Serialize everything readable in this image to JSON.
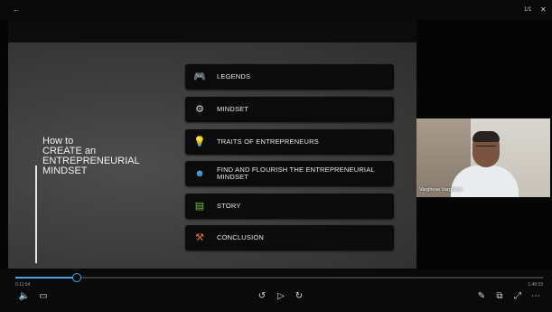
{
  "window": {
    "back_icon": "back-arrow-icon",
    "top_right_label": "1/1",
    "close_icon": "close-icon"
  },
  "slide": {
    "title_lines": [
      "How to",
      "CREATE an",
      "ENTREPRENEURIAL",
      "MINDSET"
    ],
    "menu": [
      {
        "label": "LEGENDS",
        "icon": "gamepad-icon",
        "glyph": "🎮",
        "color": "#e8703a"
      },
      {
        "label": "MINDSET",
        "icon": "head-gear-icon",
        "glyph": "⚙",
        "color": "#d9d9d9"
      },
      {
        "label": "TRAITS OF ENTREPRENEURS",
        "icon": "lightbulb-icon",
        "glyph": "💡",
        "color": "#f2c531"
      },
      {
        "label": "FIND AND FLOURISH THE ENTREPRENEURIAL MINDSET",
        "icon": "head-idea-icon",
        "glyph": "☻",
        "color": "#4aa3e8"
      },
      {
        "label": "STORY",
        "icon": "book-icon",
        "glyph": "▤",
        "color": "#6fc24a"
      },
      {
        "label": "CONCLUSION",
        "icon": "gavel-icon",
        "glyph": "⚒",
        "color": "#e8703a"
      }
    ]
  },
  "webcam": {
    "name": "Varghese Varghese"
  },
  "player": {
    "current_time": "0:11:54",
    "total_time": "1:48:33",
    "progress": 0.115,
    "accent_color": "#4aa3e8",
    "icons": {
      "volume": "volume-icon",
      "captions": "captions-icon",
      "rewind": "rewind-10-icon",
      "play": "play-icon",
      "forward": "forward-10-icon",
      "pen": "pen-icon",
      "pip": "picture-in-picture-icon",
      "fullscreen": "fullscreen-icon",
      "more": "more-options-icon"
    }
  }
}
